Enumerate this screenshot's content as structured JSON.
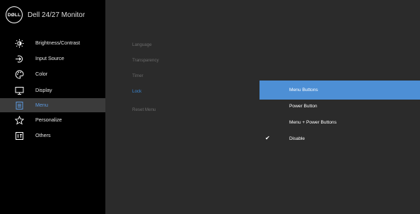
{
  "header": {
    "logo_text": "DØLL",
    "model": "Dell 24/27 Monitor"
  },
  "nav": [
    {
      "label": "Brightness/Contrast",
      "icon": "brightness-icon"
    },
    {
      "label": "Input Source",
      "icon": "input-source-icon"
    },
    {
      "label": "Color",
      "icon": "color-icon"
    },
    {
      "label": "Display",
      "icon": "display-icon"
    },
    {
      "label": "Menu",
      "icon": "menu-icon",
      "active": true
    },
    {
      "label": "Personalize",
      "icon": "star-icon"
    },
    {
      "label": "Others",
      "icon": "others-icon"
    }
  ],
  "submenu": [
    {
      "label": "Language"
    },
    {
      "label": "Transparency"
    },
    {
      "label": "Timer"
    },
    {
      "label": "Lock",
      "active": true
    },
    {
      "label": "Reset Menu"
    }
  ],
  "options": [
    {
      "label": "Menu Buttons",
      "highlighted": true
    },
    {
      "label": "Power Button"
    },
    {
      "label": "Menu + Power Buttons"
    },
    {
      "label": "Disable",
      "checked": true,
      "check_glyph": "✔"
    }
  ],
  "colors": {
    "accent": "#4d8fd5",
    "active_text": "#5e9be0",
    "sidebar_bg": "#000000",
    "panel_bg": "#2b2b2b"
  }
}
